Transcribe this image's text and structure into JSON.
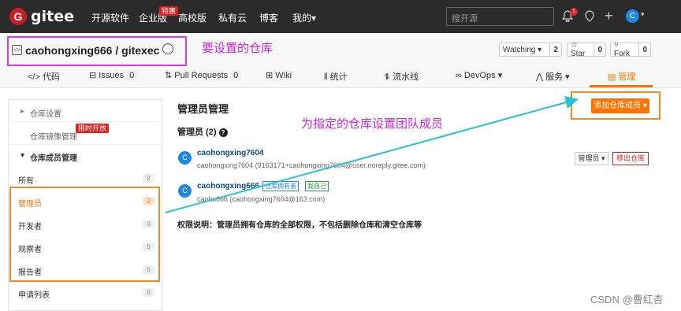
{
  "topbar": {
    "logo_text": "gitee",
    "logo_letter": "G",
    "nav": [
      "开源软件",
      "企业版",
      "高校版",
      "私有云",
      "博客",
      "我的"
    ],
    "hot_badge": "特惠",
    "search_placeholder": "搜开源",
    "notif_count": "1",
    "avatar_letter": "C",
    "my_chevron": "▾"
  },
  "repo": {
    "title": "caohongxing666 / gitexec",
    "icon_text": "<>",
    "annotation": "要设置的仓库",
    "watch": {
      "label": "Watching ▾",
      "count": "2"
    },
    "star": {
      "label": "☆ Star",
      "count": "0"
    },
    "fork": {
      "label": "⑂ Fork",
      "count": "0"
    }
  },
  "tabs": [
    {
      "label": "</> 代码"
    },
    {
      "label": "⊟ Issues",
      "count": "0"
    },
    {
      "label": "⇅ Pull Requests",
      "count": "0"
    },
    {
      "label": "⊞ Wiki"
    },
    {
      "label": "⫴ 统计"
    },
    {
      "label": "⥮ 流水线"
    },
    {
      "label": "∞ DevOps ▾"
    },
    {
      "label": "⋀ 服务 ▾"
    },
    {
      "label": "▤ 管理"
    }
  ],
  "sidebar": {
    "items": [
      {
        "label": "仓库设置",
        "prefix": "▸"
      },
      {
        "label": "仓库镜像管理",
        "badge": "限时开放"
      },
      {
        "label": "仓库成员管理",
        "prefix": "▾"
      },
      {
        "label": "所有",
        "count": "2"
      },
      {
        "label": "管理员",
        "count": "2"
      },
      {
        "label": "开发者",
        "count": "0"
      },
      {
        "label": "观察者",
        "count": "0"
      },
      {
        "label": "报告者",
        "count": "0"
      },
      {
        "label": "申请列表",
        "count": "0"
      }
    ]
  },
  "main": {
    "title": "管理员管理",
    "add_button": "添加仓库成员 ▾",
    "annotation": "为指定的仓库设置团队成员",
    "subtitle": "管理员 (2)",
    "help": "?",
    "members": [
      {
        "avatar": "C",
        "name": "caohongxing7604",
        "email": "caohongxing7604 (9163171+caohongxing7604@user.noreply.gitee.com)",
        "role": "管理员 ▾",
        "remove": "移出仓库"
      },
      {
        "avatar": "C",
        "name": "caohongxing666",
        "email": "caohx666 (caohongxing7604@163.com)",
        "tags": [
          "仓库拥有者",
          "我自己"
        ]
      }
    ],
    "permission_note": "权限说明：管理员拥有仓库的全部权限，不包括删除仓库和清空仓库等"
  },
  "watermark": "CSDN @曹红杏",
  "colors": {
    "accent": "#fe7300",
    "topbar": "#2b2b2b",
    "annotation": "#d020e0",
    "arrow": "#27c4d6"
  }
}
